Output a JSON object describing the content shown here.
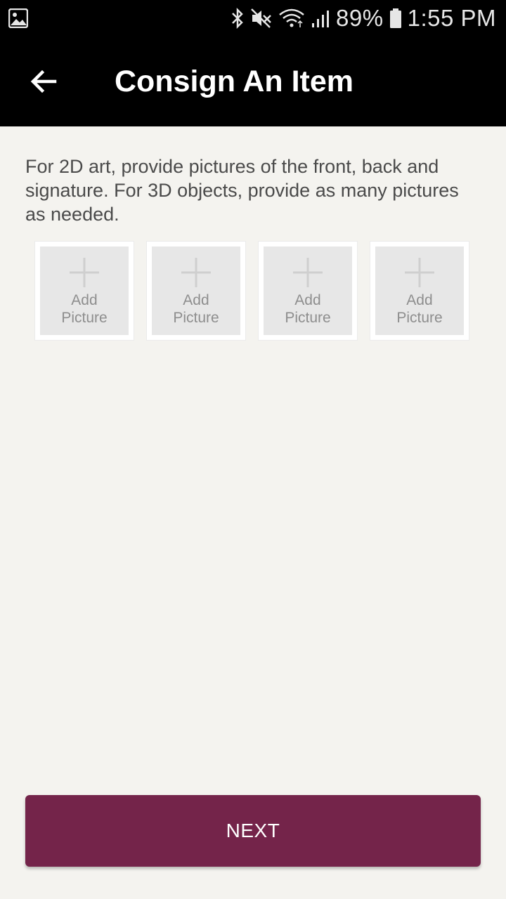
{
  "status_bar": {
    "battery_percent": "89%",
    "time": "1:55 PM",
    "icons": [
      "gallery-icon",
      "bluetooth-icon",
      "mute-icon",
      "wifi-icon",
      "signal-icon",
      "battery-icon"
    ]
  },
  "app_bar": {
    "title": "Consign An Item",
    "back_icon": "arrow-left-icon"
  },
  "instructions": "For 2D art, provide pictures of the front, back and signature. For 3D objects, provide as many pictures as needed.",
  "photo_slots": [
    {
      "label": "Add\nPicture",
      "icon": "plus-icon"
    },
    {
      "label": "Add\nPicture",
      "icon": "plus-icon"
    },
    {
      "label": "Add\nPicture",
      "icon": "plus-icon"
    },
    {
      "label": "Add\nPicture",
      "icon": "plus-icon"
    }
  ],
  "next_button": {
    "label": "NEXT"
  },
  "colors": {
    "bar_background": "#000000",
    "page_background": "#f4f3ef",
    "accent": "#74244a",
    "tile_fill": "#e7e7e7"
  }
}
